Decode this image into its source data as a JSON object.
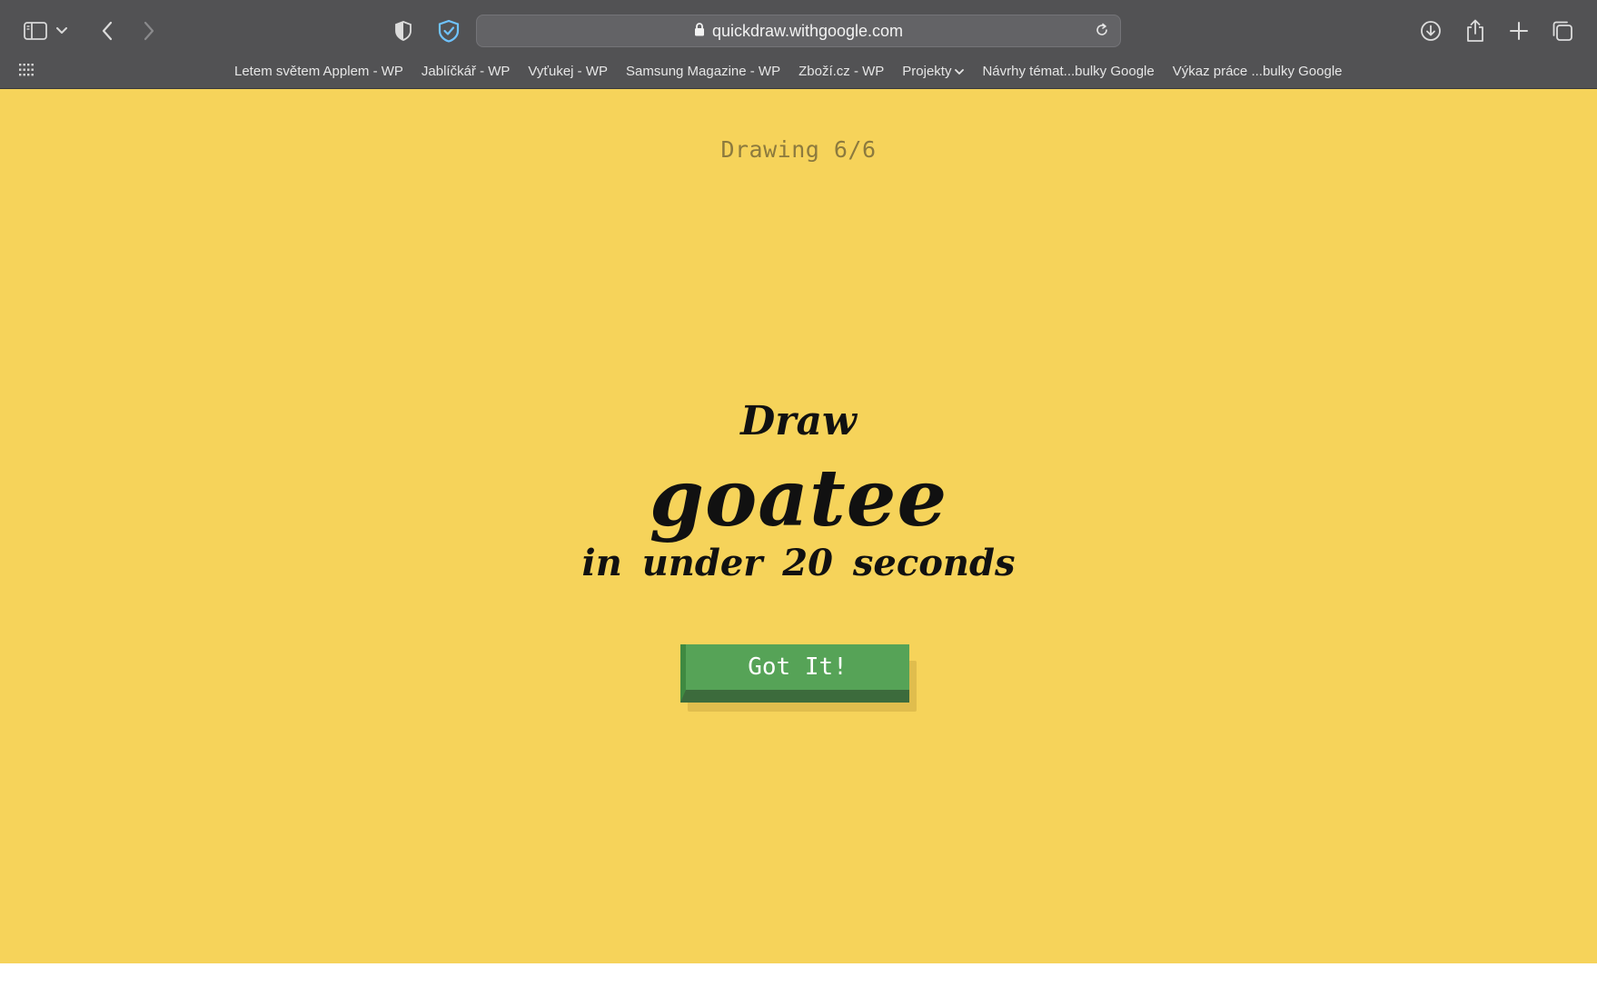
{
  "browser": {
    "url": "quickdraw.withgoogle.com",
    "toolbar_icons": [
      "sidebar-icon",
      "chevron-down-icon",
      "back-icon",
      "forward-icon",
      "shield-icon",
      "privacy-shield-icon",
      "lock-icon",
      "reload-icon",
      "download-icon",
      "share-icon",
      "new-tab-icon",
      "tabs-overview-icon"
    ],
    "bookmarks": [
      {
        "label": "Letem světem Applem - WP"
      },
      {
        "label": "Jablíčkář - WP"
      },
      {
        "label": "Vyťukej - WP"
      },
      {
        "label": "Samsung Magazine - WP"
      },
      {
        "label": "Zboží.cz - WP"
      },
      {
        "label": "Projekty",
        "has_dropdown": true
      },
      {
        "label": "Návrhy témat...bulky Google"
      },
      {
        "label": "Výkaz práce ...bulky Google"
      }
    ]
  },
  "page": {
    "background": "#f6d35a",
    "counter": "Drawing 6/6",
    "prompt_prefix": "Draw",
    "prompt_word": "goatee",
    "prompt_suffix": "in under 20 seconds",
    "button_label": "Got It!",
    "button_color": "#56a357"
  }
}
